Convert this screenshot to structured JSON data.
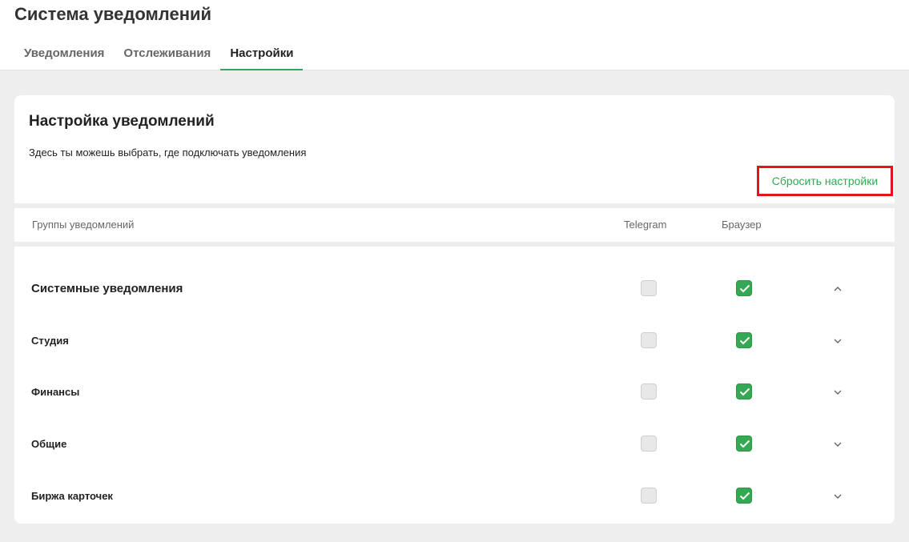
{
  "app": {
    "title": "Система уведомлений"
  },
  "tabs": [
    {
      "label": "Уведомления"
    },
    {
      "label": "Отслеживания"
    },
    {
      "label": "Настройки",
      "active": true
    }
  ],
  "settings": {
    "title": "Настройка уведомлений",
    "description": "Здесь ты можешь выбрать, где подключать уведомления",
    "reset_label": "Сбросить настройки"
  },
  "columns": {
    "groups": "Группы уведомлений",
    "telegram": "Telegram",
    "browser": "Браузер"
  },
  "groups": [
    {
      "label": "Системные уведомления",
      "telegram": false,
      "browser": true,
      "expanded": true
    },
    {
      "label": "Студия",
      "telegram": false,
      "browser": true,
      "expanded": false
    },
    {
      "label": "Финансы",
      "telegram": false,
      "browser": true,
      "expanded": false
    },
    {
      "label": "Общие",
      "telegram": false,
      "browser": true,
      "expanded": false
    },
    {
      "label": "Биржа карточек",
      "telegram": false,
      "browser": true,
      "expanded": false
    }
  ],
  "colors": {
    "accent": "#34a853",
    "highlight": "#e3141b"
  },
  "icons": {
    "check": "check-icon",
    "chevron_up": "chevron-up-icon",
    "chevron_down": "chevron-down-icon"
  }
}
